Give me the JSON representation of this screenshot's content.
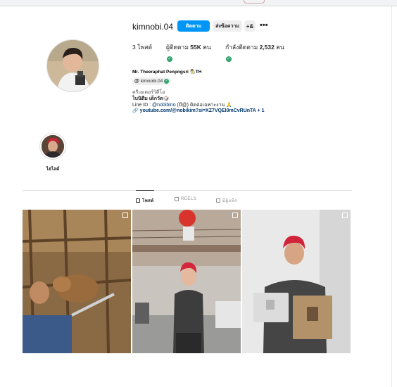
{
  "profile": {
    "username": "kimnobi.04",
    "follow_label": "ติดตาม",
    "message_label": "ส่งข้อความ",
    "suggest_label": "+&",
    "more_label": "•••"
  },
  "stats": {
    "posts_value": "3",
    "posts_label": " โพสต์",
    "followers_label": "ผู้ติดตาม ",
    "followers_value": "55K",
    "followers_unit": " คน",
    "following_label": "กำลังติดตาม ",
    "following_value": "2,532",
    "following_unit": " คน"
  },
  "bio": {
    "full_name": "Mr. Theeraphat Penpngsri 👨‍🔬TH",
    "threads_handle": "kimnobi.04",
    "line1": "ครีเอเตอร์วิดีโอ",
    "line2": "ไบนิดีม เด็กวัด🎲",
    "line3_prefix": "Line ID : ",
    "line3_mention": "@nobibino",
    "line3_suffix": " (มี@) ติดต่อเฉพาะงาน 🙏",
    "link": "youtube.com/@nobikim?si=XZ7VQEI0mCvRUnTA + 1"
  },
  "highlight": {
    "label": "ไฮไลต์"
  },
  "tabs": [
    {
      "label": "โพสต์",
      "icon": "grid-icon",
      "active": true
    },
    {
      "label": "REELS",
      "icon": "reels-icon",
      "active": false
    },
    {
      "label": "มีผู้แท็ก",
      "icon": "tagged-icon",
      "active": false
    }
  ],
  "colors": {
    "accent": "#0095f6",
    "verified_check": "#2fa36b",
    "link": "#00376b"
  }
}
